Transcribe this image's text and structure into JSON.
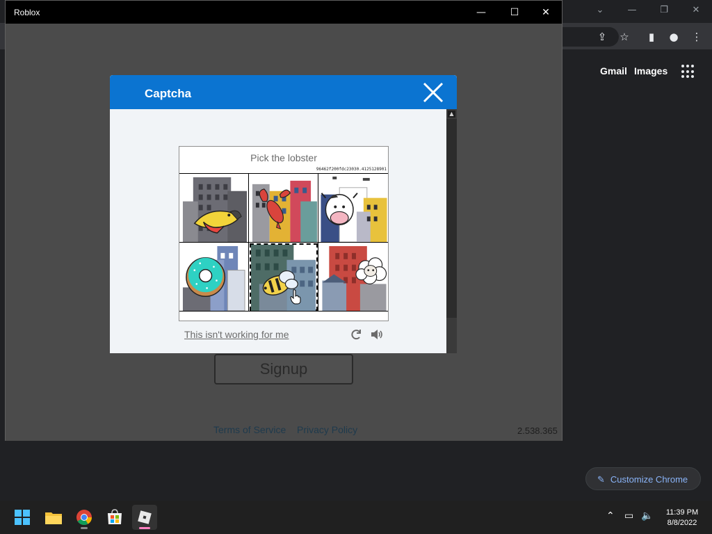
{
  "chrome": {
    "links": {
      "gmail": "Gmail",
      "images": "Images"
    },
    "customize_label": "Customize Chrome",
    "icons": [
      "chevron-down-icon",
      "minimize-icon",
      "restore-icon",
      "close-icon",
      "share-icon",
      "star-icon",
      "side-panel-icon",
      "profile-icon",
      "menu-icon",
      "apps-icon",
      "pencil-icon"
    ]
  },
  "roblox_window": {
    "title": "Roblox",
    "signup_label": "Signup",
    "footer": {
      "terms": "Terms of Service",
      "privacy": "Privacy Policy"
    },
    "version": "2.538.365"
  },
  "captcha": {
    "title": "Captcha",
    "prompt": "Pick the lobster",
    "hash": "96462f200fdc23030.4125128901",
    "tiles": [
      {
        "name": "tile-parrot",
        "subject": "parrot",
        "selected": false
      },
      {
        "name": "tile-lobster",
        "subject": "lobster",
        "selected": false
      },
      {
        "name": "tile-cow",
        "subject": "cow",
        "selected": false
      },
      {
        "name": "tile-donut",
        "subject": "donut",
        "selected": false
      },
      {
        "name": "tile-bee",
        "subject": "bee",
        "selected": true
      },
      {
        "name": "tile-sheep",
        "subject": "sheep",
        "selected": false
      }
    ],
    "not_working_link": "This isn't working for me",
    "colors": {
      "header": "#0b74d1",
      "body": "#f1f4f7"
    }
  },
  "taskbar": {
    "apps": [
      "start-icon",
      "file-explorer-icon",
      "chrome-icon",
      "microsoft-store-icon",
      "roblox-icon"
    ],
    "clock": {
      "time": "11:39 PM",
      "date": "8/8/2022"
    }
  }
}
